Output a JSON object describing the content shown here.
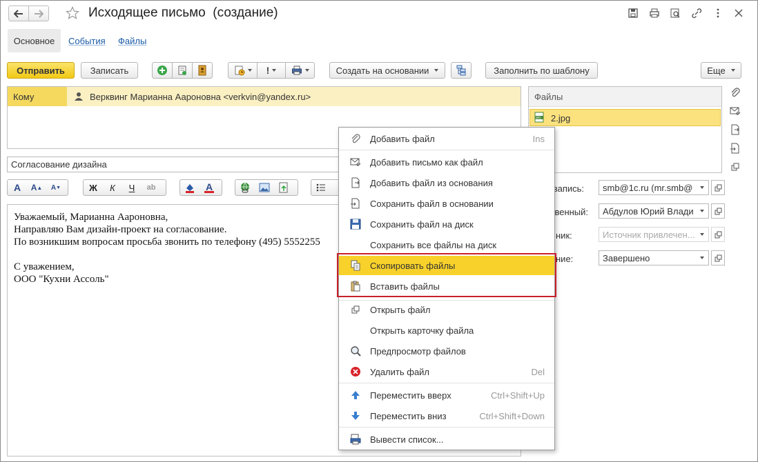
{
  "window": {
    "title": "Исходящее письмо  (создание)"
  },
  "tabs": [
    {
      "label": "Основное"
    },
    {
      "label": "События"
    },
    {
      "label": "Файлы"
    }
  ],
  "toolbar": {
    "send_label": "Отправить",
    "save_label": "Записать",
    "create_based_label": "Создать на основании",
    "fill_template_label": "Заполнить по шаблону",
    "more_label": "Еще",
    "exclaim": "!"
  },
  "to": {
    "label": "Кому",
    "recipient": "Верквинг Марианна Аароновна <verkvin@yandex.ru>"
  },
  "subject": {
    "value": "Согласование дизайна"
  },
  "format_toolbar": {
    "bold": "Ж",
    "italic": "К",
    "underline": "Ч",
    "font_a": "A"
  },
  "body": {
    "lines": [
      "Уважаемый, Марианна Аароновна,",
      "Направляю Вам дизайн-проект на согласование.",
      "По возникшим вопросам просьба звонить по телефону (495) 5552255",
      "",
      "С уважением,",
      "ООО \"Кухни Ассоль\""
    ]
  },
  "files_panel": {
    "header": "Файлы",
    "items": [
      {
        "name": "2.jpg",
        "icon": "jpg-file-icon"
      }
    ]
  },
  "props": [
    {
      "label": "я запись:",
      "value": "smb@1c.ru (mr.smb@",
      "placeholder": false
    },
    {
      "label": "ственный:",
      "value": "Абдулов Юрий Влади",
      "placeholder": false
    },
    {
      "label": "ник:",
      "value": "Источник привлечен...",
      "placeholder": true
    },
    {
      "label": "ние:",
      "value": "Завершено",
      "placeholder": false
    }
  ],
  "context_menu": {
    "items": [
      {
        "label": "Добавить файл",
        "shortcut": "Ins",
        "icon": "paperclip-icon"
      },
      {
        "label": "Добавить письмо как файл",
        "shortcut": "",
        "icon": "envelope-attach-icon"
      },
      {
        "label": "Добавить файл из основания",
        "shortcut": "",
        "icon": "file-import-icon"
      },
      {
        "label": "Сохранить файл в основании",
        "shortcut": "",
        "icon": "file-save-base-icon"
      },
      {
        "label": "Сохранить файл на диск",
        "shortcut": "",
        "icon": "floppy-disk-icon"
      },
      {
        "label": "Сохранить все файлы на диск",
        "shortcut": "",
        "icon": ""
      },
      {
        "label": "Скопировать файлы",
        "shortcut": "",
        "icon": "copy-files-icon"
      },
      {
        "label": "Вставить файлы",
        "shortcut": "",
        "icon": "paste-files-icon"
      },
      {
        "label": "Открыть файл",
        "shortcut": "",
        "icon": "open-file-icon"
      },
      {
        "label": "Открыть карточку файла",
        "shortcut": "",
        "icon": ""
      },
      {
        "label": "Предпросмотр файлов",
        "shortcut": "",
        "icon": "magnifier-icon"
      },
      {
        "label": "Удалить файл",
        "shortcut": "Del",
        "icon": "delete-red-icon"
      },
      {
        "label": "Переместить вверх",
        "shortcut": "Ctrl+Shift+Up",
        "icon": "arrow-up-icon"
      },
      {
        "label": "Переместить вниз",
        "shortcut": "Ctrl+Shift+Down",
        "icon": "arrow-down-icon"
      },
      {
        "label": "Вывести список...",
        "shortcut": "",
        "icon": "list-print-icon"
      }
    ]
  },
  "colors": {
    "accent_yellow": "#f5d43b",
    "highlight_row": "#fbe27f",
    "red_outline": "#c8202a",
    "link_blue": "#1a5aa6"
  }
}
